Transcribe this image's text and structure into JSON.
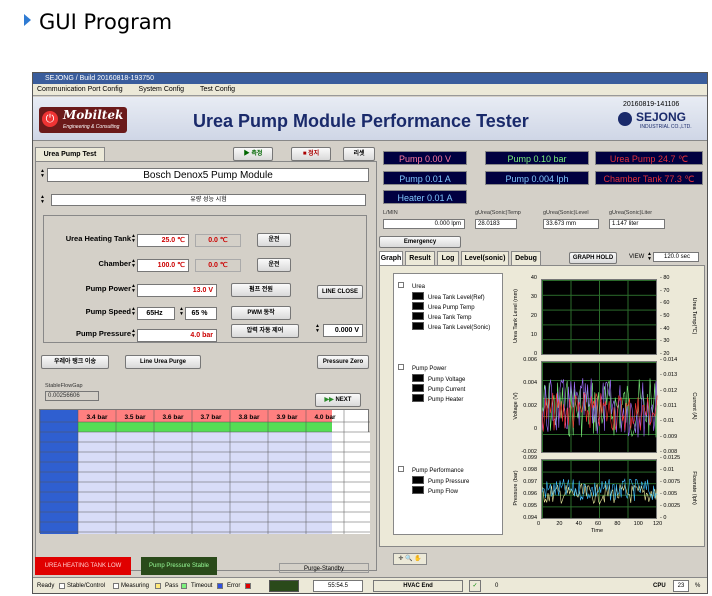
{
  "slide_title": "GUI Program",
  "window": {
    "title": "SEJONG / Build 20160818-193750",
    "menu": [
      "Communication Port Config",
      "System Config",
      "Test Config"
    ]
  },
  "header": {
    "logo_name": "Mobiltek",
    "logo_sub": "Engineering & Consulting",
    "app_title": "Urea Pump Module Performance Tester",
    "version": "20160819-141106",
    "brand": "SEJONG",
    "brand_sub": "INDUSTRIAL CO.,LTD."
  },
  "left": {
    "tab": "Urea Pump Test",
    "btn_measure": "측정",
    "btn_stop": "정지",
    "btn_reset": "리셋",
    "module": "Bosch Denox5 Pump Module",
    "mode": "유량 성능 시험",
    "urea_heating_label": "Urea Heating Tank",
    "urea_heating_set": "25.0 ℃",
    "urea_heating_read": "0.0 ℃",
    "urea_heating_btn": "운전",
    "chamber_label": "Chamber",
    "chamber_set": "100.0 ℃",
    "chamber_read": "0.0 ℃",
    "chamber_btn": "운전",
    "pump_power_label": "Pump Power",
    "pump_power": "13.0 V",
    "pump_power_btn": "펌프 전원",
    "line_close_btn": "LINE CLOSE",
    "pump_speed_label": "Pump Speed",
    "pump_speed_hz": "65Hz",
    "pump_speed_pct": "65 %",
    "pwm_btn": "PWM 동작",
    "pump_pressure_label": "Pump Pressure",
    "pump_pressure": "4.0 bar",
    "pressure_auto_btn": "압력 자동 제어",
    "pressure_value": "0.000 V",
    "urea_tank_btn": "우레아 탱크 이송",
    "line_purge_btn": "Line Urea Purge",
    "pressure_zero_btn": "Pressure Zero",
    "stable_gap_label": "StableFlowGap",
    "stable_gap": "0.00256606",
    "next_btn": "NEXT",
    "table_headers": [
      "3.4 bar",
      "3.5 bar",
      "3.6 bar",
      "3.7 bar",
      "3.8 bar",
      "3.9 bar",
      "4.0 bar"
    ]
  },
  "status_top": {
    "pump_v": "Pump 0.00 V",
    "pump_bar": "Pump 0.10 bar",
    "pump_temp": "Urea Pump 24.7 ℃",
    "pump_a": "Pump 0.01 A",
    "pump_lph": "Pump 0.004 lph",
    "chamber_tank": "Chamber Tank 77.3 ℃",
    "heater": "Heater 0.01 A"
  },
  "readouts": {
    "lmin_label": "L/MIN",
    "lmin": "0.000 lpm",
    "temp_label": "gUrea(Sonic)Temp",
    "temp": "28.0183",
    "level_label": "gUrea(Sonic)Level",
    "level": "33.673 mm",
    "liter_label": "gUrea(Sonic)Liter",
    "liter": "1.147 liter"
  },
  "emergency_btn": "Emergency",
  "graph_tabs": [
    "Graph",
    "Result",
    "Log",
    "Level(sonic)",
    "Debug"
  ],
  "graph_hold_btn": "GRAPH HOLD",
  "view_label": "VIEW",
  "view_value": "120.0 sec",
  "legend": {
    "urea_group": "Urea",
    "urea_items": [
      "Urea Tank Level(Ref)",
      "Urea Pump Temp",
      "Urea Tank Temp",
      "Urea Tank Level(Sonic)"
    ],
    "power_group": "Pump Power",
    "power_items": [
      "Pump Voltage",
      "Pump Current",
      "Pump Heater"
    ],
    "perf_group": "Pump Performance",
    "perf_items": [
      "Pump Pressure",
      "Pump Flow"
    ]
  },
  "chart_data": [
    {
      "type": "line",
      "ylabel": "Urea Tank Level (mm)",
      "y2label": "Urea Temp(℃)",
      "y_ticks": [
        "40",
        "30",
        "20",
        "10",
        "0"
      ],
      "y2_ticks": [
        "80",
        "70",
        "60",
        "50",
        "40",
        "30",
        "20"
      ]
    },
    {
      "type": "line",
      "ylabel": "Voltage (V)",
      "y2label": "Current (A)",
      "y_ticks": [
        "0.006",
        "0.004",
        "0.002",
        "0",
        "-0.002"
      ],
      "y2_ticks": [
        "0.014",
        "0.013",
        "0.012",
        "0.011",
        "0.01",
        "0.009",
        "0.008"
      ]
    },
    {
      "type": "line",
      "ylabel": "Pressure (bar)",
      "y2label": "Flowrate (lph)",
      "y_ticks": [
        "0.099",
        "0.098",
        "0.097",
        "0.096",
        "0.095",
        "0.094"
      ],
      "y2_ticks": [
        "0.0125",
        "0.01",
        "0.0075",
        "0.005",
        "0.0025",
        "0"
      ],
      "x_ticks": [
        "0",
        "20",
        "40",
        "60",
        "80",
        "100",
        "120"
      ],
      "xlabel": "Time"
    }
  ],
  "bottom_bar": {
    "heating_low": "UREA HEATING TANK LOW",
    "pressure_stable": "Pump Pressure Stable",
    "purge": "Purge-Standby",
    "ready": "Ready",
    "stable_control": "Stable/Control",
    "measuring": "Measuring",
    "pass": "Pass",
    "timeout": "Timeout",
    "error": "Error",
    "time": "55:54.5",
    "hvac": "HVAC End",
    "count": "0",
    "cpu_label": "CPU",
    "cpu": "23",
    "pct": "%"
  }
}
